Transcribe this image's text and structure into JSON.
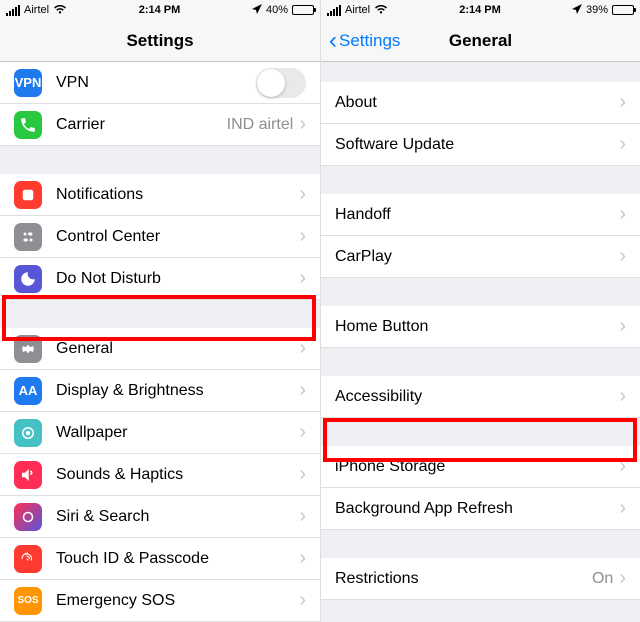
{
  "left": {
    "status": {
      "carrier": "Airtel",
      "time": "2:14 PM",
      "battery_pct": "40%",
      "battery_fill": 40
    },
    "nav": {
      "title": "Settings"
    },
    "rows": {
      "vpn": {
        "label": "VPN"
      },
      "carrier": {
        "label": "Carrier",
        "detail": "IND airtel"
      },
      "notifications": {
        "label": "Notifications"
      },
      "control_center": {
        "label": "Control Center"
      },
      "dnd": {
        "label": "Do Not Disturb"
      },
      "general": {
        "label": "General"
      },
      "display": {
        "label": "Display & Brightness"
      },
      "wallpaper": {
        "label": "Wallpaper"
      },
      "sounds": {
        "label": "Sounds & Haptics"
      },
      "siri": {
        "label": "Siri & Search"
      },
      "touchid": {
        "label": "Touch ID & Passcode"
      },
      "sos": {
        "label": "Emergency SOS"
      }
    }
  },
  "right": {
    "status": {
      "carrier": "Airtel",
      "time": "2:14 PM",
      "battery_pct": "39%",
      "battery_fill": 39
    },
    "nav": {
      "back": "Settings",
      "title": "General"
    },
    "rows": {
      "about": {
        "label": "About"
      },
      "software_update": {
        "label": "Software Update"
      },
      "handoff": {
        "label": "Handoff"
      },
      "carplay": {
        "label": "CarPlay"
      },
      "home_button": {
        "label": "Home Button"
      },
      "accessibility": {
        "label": "Accessibility"
      },
      "iphone_storage": {
        "label": "iPhone Storage"
      },
      "bg_refresh": {
        "label": "Background App Refresh"
      },
      "restrictions": {
        "label": "Restrictions",
        "detail": "On"
      }
    }
  }
}
